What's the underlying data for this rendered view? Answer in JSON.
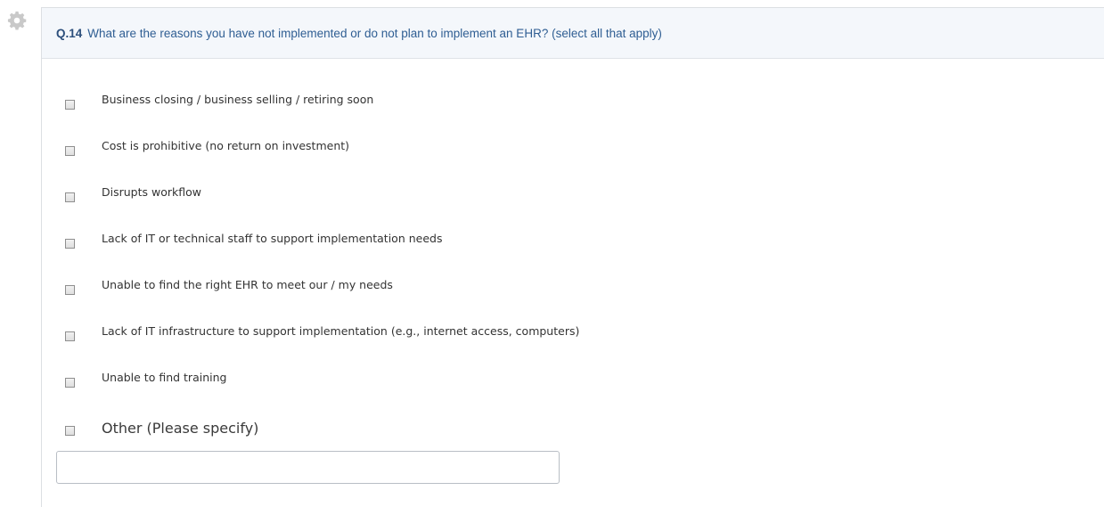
{
  "question": {
    "number": "Q.14",
    "text": "What are the reasons you have not implemented or do not plan to implement an EHR? (select all that apply)"
  },
  "options": [
    {
      "label": "Business closing / business selling / retiring soon",
      "checked": false
    },
    {
      "label": "Cost is prohibitive (no return on investment)",
      "checked": false
    },
    {
      "label": "Disrupts workflow",
      "checked": false
    },
    {
      "label": "Lack of IT or technical staff to support implementation needs",
      "checked": false
    },
    {
      "label": "Unable to find the right EHR to meet our / my needs",
      "checked": false
    },
    {
      "label": "Lack of IT infrastructure to support implementation (e.g., internet access, computers)",
      "checked": false
    },
    {
      "label": "Unable to find training",
      "checked": false
    },
    {
      "label": "Other (Please specify)",
      "checked": false
    }
  ],
  "other_input": {
    "value": ""
  },
  "colors": {
    "header_bg": "#f4f7fb",
    "question_text": "#2f5e93",
    "border": "#dcdfe3"
  },
  "icons": {
    "settings": "gear-icon"
  }
}
